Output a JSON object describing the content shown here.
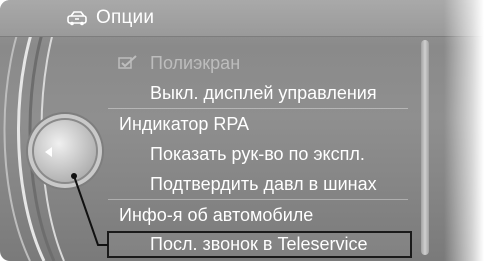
{
  "header": {
    "title": "Опции",
    "icon": "settings-vehicle-icon"
  },
  "menu": {
    "items": [
      {
        "label": "Полиэкран",
        "state": "disabled",
        "icon": "checkbox-checked-icon"
      },
      {
        "label": "Выкл. дисплей управления",
        "state": "normal"
      },
      {
        "label": "Индикатор RPA",
        "state": "section"
      },
      {
        "label": "Показать рук-во по экспл.",
        "state": "normal"
      },
      {
        "label": "Подтвердить давл в шинах",
        "state": "normal"
      },
      {
        "label": "Инфо-я об автомобиле",
        "state": "section"
      },
      {
        "label": "Посл. звонок в Teleservice",
        "state": "selected"
      }
    ]
  },
  "controller": {
    "icon": "left-arrow-icon"
  },
  "colors": {
    "text": "#ffffff",
    "disabled_text": "#bdbdbd",
    "selection_border": "#1a1a1a",
    "background": "#8f8f8f"
  }
}
